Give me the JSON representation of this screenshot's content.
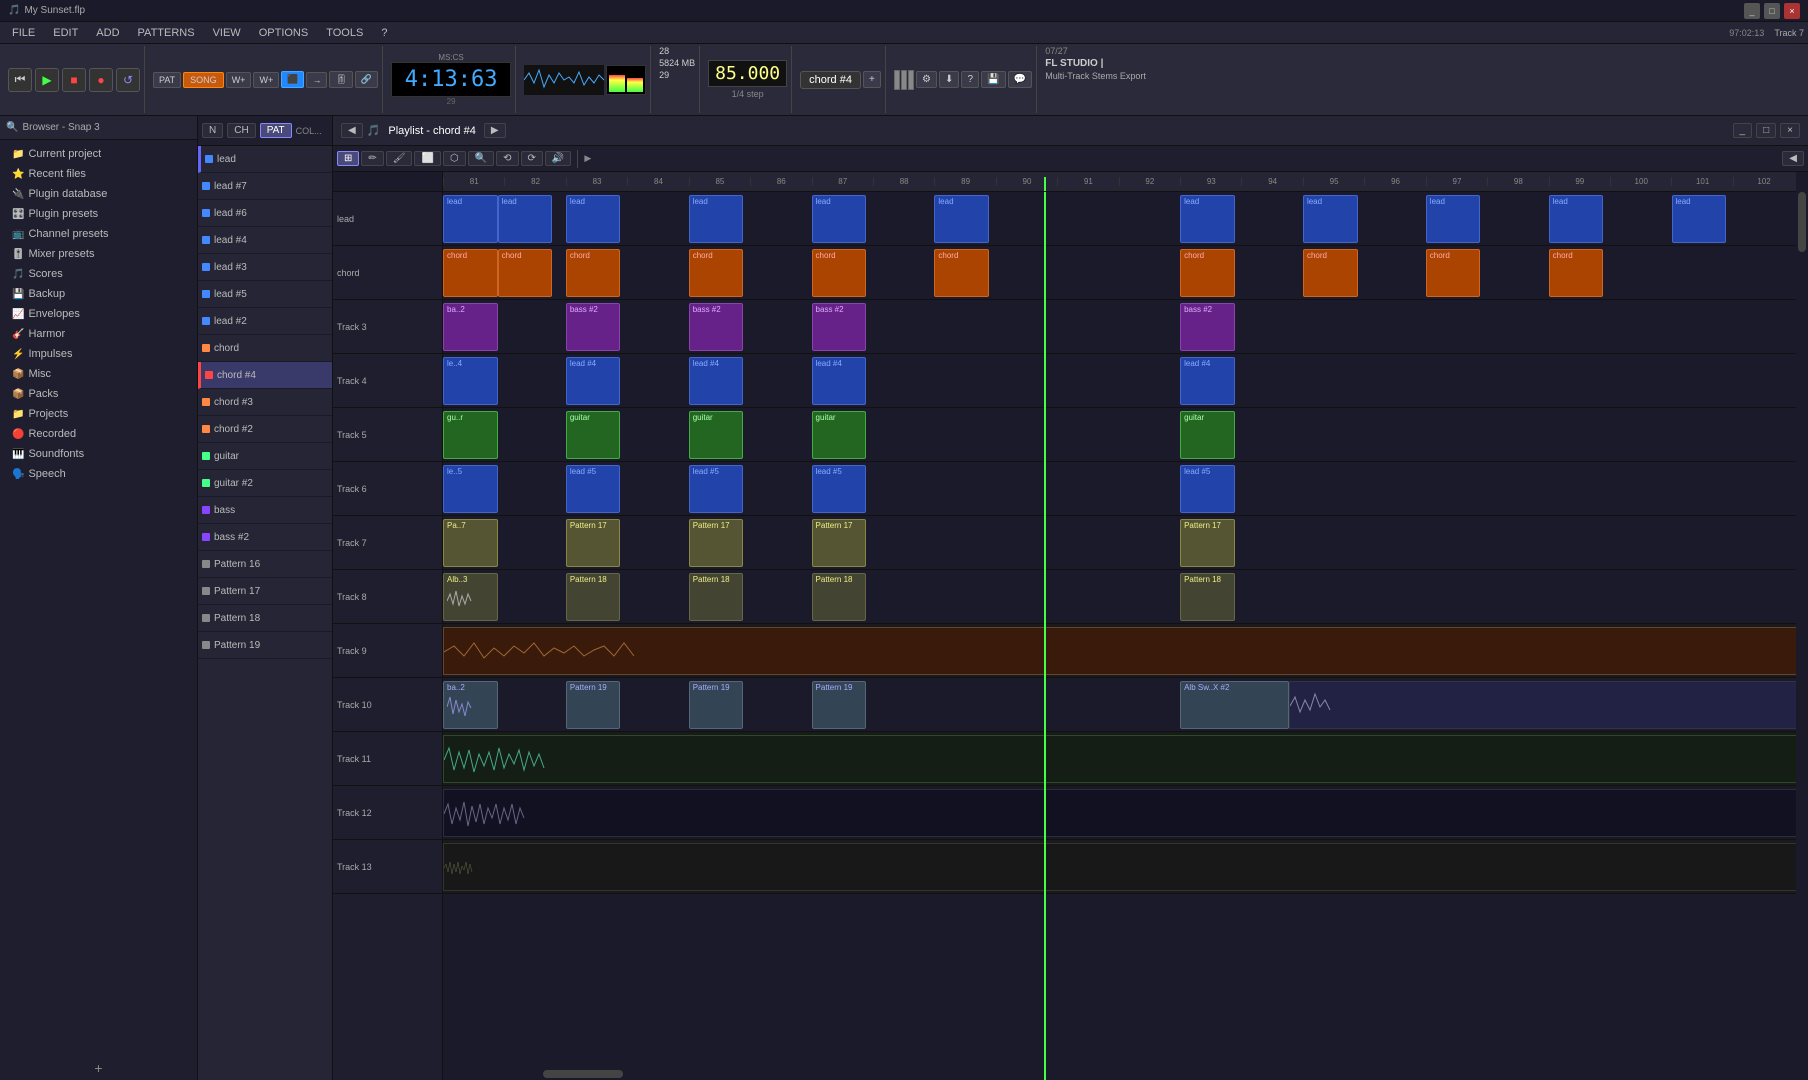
{
  "window": {
    "title": "My Sunset.flp"
  },
  "titleBar": {
    "buttons": [
      "minimize",
      "maximize",
      "close"
    ],
    "title": "My Sunset.flp"
  },
  "menuBar": {
    "items": [
      "FILE",
      "EDIT",
      "ADD",
      "PATTERNS",
      "VIEW",
      "OPTIONS",
      "TOOLS",
      "?"
    ]
  },
  "statusBar": {
    "time": "97:02:13",
    "trackLabel": "Track 7"
  },
  "transport": {
    "timeDisplay": "4:13:63",
    "subDisplay": "MS:CS",
    "bar": "29",
    "tempoDisplay": "85.000",
    "timeSig": "1/4 step",
    "chordLabel": "chord #4",
    "memory": "5824 MB",
    "cpuLeft": "28",
    "cpuRight": "29"
  },
  "flInfo": {
    "trackCount": "07/27",
    "appName": "FL STUDIO |",
    "mode": "Multi-Track Stems Export"
  },
  "sidebar": {
    "header": "Browser - Snap 3",
    "items": [
      {
        "label": "Current project",
        "icon": "📁",
        "type": "folder"
      },
      {
        "label": "Recent files",
        "icon": "⭐",
        "type": "folder"
      },
      {
        "label": "Plugin database",
        "icon": "🔌",
        "type": "folder"
      },
      {
        "label": "Plugin presets",
        "icon": "🎛️",
        "type": "folder"
      },
      {
        "label": "Channel presets",
        "icon": "📺",
        "type": "folder"
      },
      {
        "label": "Mixer presets",
        "icon": "🎚️",
        "type": "folder"
      },
      {
        "label": "Scores",
        "icon": "🎵",
        "type": "folder"
      },
      {
        "label": "Backup",
        "icon": "💾",
        "type": "folder"
      },
      {
        "label": "Envelopes",
        "icon": "📈",
        "type": "folder"
      },
      {
        "label": "Harmor",
        "icon": "🎸",
        "type": "folder"
      },
      {
        "label": "Impulses",
        "icon": "⚡",
        "type": "folder"
      },
      {
        "label": "Misc",
        "icon": "📦",
        "type": "folder"
      },
      {
        "label": "Packs",
        "icon": "📦",
        "type": "folder"
      },
      {
        "label": "Projects",
        "icon": "📁",
        "type": "folder"
      },
      {
        "label": "Recorded",
        "icon": "🔴",
        "type": "folder"
      },
      {
        "label": "Soundfonts",
        "icon": "🎹",
        "type": "folder"
      },
      {
        "label": "Speech",
        "icon": "🗣️",
        "type": "folder"
      }
    ],
    "addButton": "+"
  },
  "patternList": {
    "items": [
      {
        "name": "lead",
        "color": "#4488ff"
      },
      {
        "name": "lead #7",
        "color": "#4488ff"
      },
      {
        "name": "lead #6",
        "color": "#4488ff"
      },
      {
        "name": "lead #4",
        "color": "#4488ff"
      },
      {
        "name": "lead #3",
        "color": "#4488ff"
      },
      {
        "name": "lead #5",
        "color": "#4488ff"
      },
      {
        "name": "lead #2",
        "color": "#4488ff"
      },
      {
        "name": "chord",
        "color": "#ff8844"
      },
      {
        "name": "chord #4",
        "color": "#ff4444",
        "selected": true,
        "active": true
      },
      {
        "name": "chord #3",
        "color": "#ff8844"
      },
      {
        "name": "chord #2",
        "color": "#ff8844"
      },
      {
        "name": "guitar",
        "color": "#44ff88"
      },
      {
        "name": "guitar #2",
        "color": "#44ff88"
      },
      {
        "name": "bass",
        "color": "#8844ff"
      },
      {
        "name": "bass #2",
        "color": "#8844ff"
      },
      {
        "name": "Pattern 16",
        "color": "#888888"
      },
      {
        "name": "Pattern 17",
        "color": "#888888"
      },
      {
        "name": "Pattern 18",
        "color": "#888888"
      },
      {
        "name": "Pattern 19",
        "color": "#888888"
      }
    ]
  },
  "playlist": {
    "title": "Playlist - chord #4",
    "tracks": [
      {
        "label": "lead",
        "num": ""
      },
      {
        "label": "chord",
        "num": ""
      },
      {
        "label": "Track 3",
        "num": ""
      },
      {
        "label": "Track 4",
        "num": ""
      },
      {
        "label": "Track 5",
        "num": ""
      },
      {
        "label": "Track 6",
        "num": ""
      },
      {
        "label": "Track 7",
        "num": ""
      },
      {
        "label": "Track 8",
        "num": ""
      },
      {
        "label": "Track 9",
        "num": ""
      },
      {
        "label": "Track 10",
        "num": ""
      },
      {
        "label": "Track 11",
        "num": ""
      },
      {
        "label": "Track 12",
        "num": ""
      },
      {
        "label": "Track 13",
        "num": ""
      }
    ],
    "ruler": {
      "marks": [
        "81",
        "82",
        "83",
        "84",
        "85",
        "86",
        "87",
        "88",
        "89",
        "90",
        "91",
        "92",
        "93",
        "94",
        "95",
        "96",
        "97",
        "98",
        "99",
        "100",
        "101",
        "102"
      ]
    },
    "playheadPosition": "44%"
  },
  "icons": {
    "play": "▶",
    "stop": "■",
    "pause": "⏸",
    "record": "●",
    "loop": "🔁",
    "rewind": "⏮",
    "fastforward": "⏭",
    "back": "⏪",
    "forward": "⏩"
  }
}
